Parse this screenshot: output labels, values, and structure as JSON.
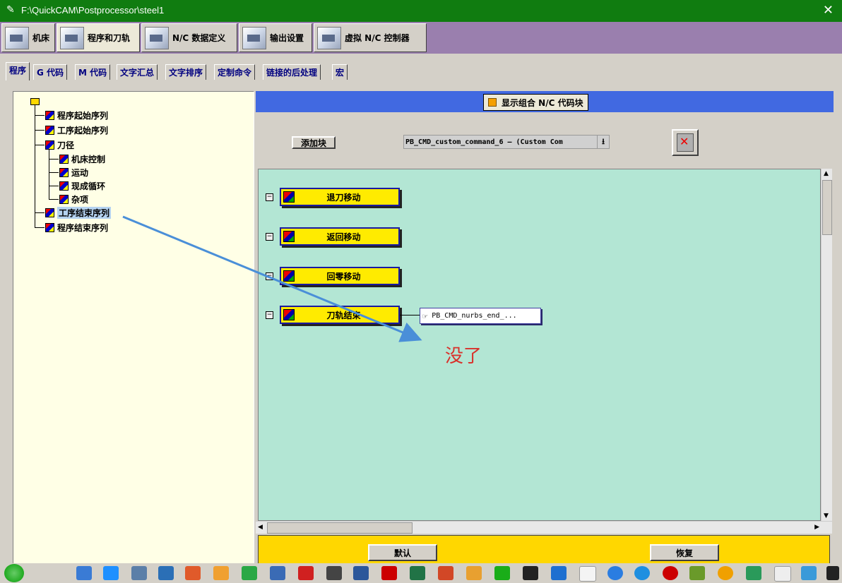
{
  "window": {
    "title": "F:\\QuickCAM\\Postprocessor\\steel1"
  },
  "main_tabs": [
    {
      "label": "机床"
    },
    {
      "label": "程序和刀轨"
    },
    {
      "label": "N/C 数据定义"
    },
    {
      "label": "输出设置"
    },
    {
      "label": "虚拟 N/C 控制器"
    }
  ],
  "sub_tabs": [
    {
      "label": "程序"
    },
    {
      "label": "G 代码"
    },
    {
      "label": "M 代码"
    },
    {
      "label": "文字汇总"
    },
    {
      "label": "文字排序"
    },
    {
      "label": "定制命令"
    },
    {
      "label": "链接的后处理"
    },
    {
      "label": "宏"
    }
  ],
  "tree": [
    {
      "label": "程序起始序列"
    },
    {
      "label": "工序起始序列"
    },
    {
      "label": "刀径"
    },
    {
      "label": "机床控制"
    },
    {
      "label": "运动"
    },
    {
      "label": "现成循环"
    },
    {
      "label": "杂项"
    },
    {
      "label": "工序结束序列"
    },
    {
      "label": "程序结束序列"
    }
  ],
  "toolbar": {
    "show_combined_label": "显示组合 N/C 代码块",
    "add_block_label": "添加块",
    "command_select_value": "PB_CMD_custom_command_6 — (Custom Com"
  },
  "blocks": [
    {
      "label": "退刀移动"
    },
    {
      "label": "返回移动"
    },
    {
      "label": "回零移动"
    },
    {
      "label": "刀轨结束"
    }
  ],
  "command_node": {
    "label": "PB_CMD_nurbs_end_..."
  },
  "bottom": {
    "default_label": "默认",
    "restore_label": "恢复"
  },
  "annotation": {
    "text": "没了",
    "color": "#d9312b"
  },
  "colors": {
    "title_bar": "#107c10",
    "tab_strip": "#9a7fae",
    "header_bar": "#4169e1",
    "canvas": "#b3e6d4",
    "block": "#ffeb00",
    "bottom_bar": "#ffd700",
    "arrow": "#4a8fd8"
  }
}
